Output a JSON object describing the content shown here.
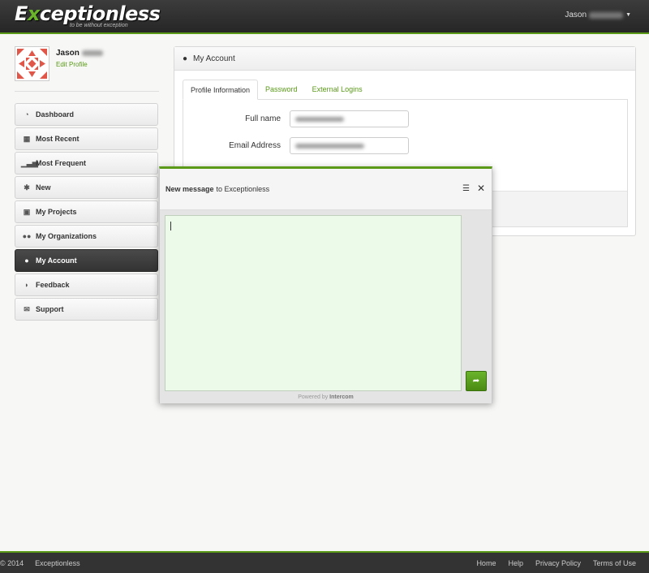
{
  "header": {
    "brand_first": "E",
    "brand_x": "x",
    "brand_rest": "ceptionless",
    "tagline": "to be without exception",
    "user_name": "Jason"
  },
  "profile": {
    "name": "Jason",
    "edit_label": "Edit Profile"
  },
  "sidebar": {
    "items": [
      {
        "label": "Dashboard",
        "icon": "dashboard-icon"
      },
      {
        "label": "Most Recent",
        "icon": "calendar-icon"
      },
      {
        "label": "Most Frequent",
        "icon": "signal-icon"
      },
      {
        "label": "New",
        "icon": "asterisk-icon"
      },
      {
        "label": "My Projects",
        "icon": "briefcase-icon"
      },
      {
        "label": "My Organizations",
        "icon": "group-icon"
      },
      {
        "label": "My Account",
        "icon": "user-icon",
        "active": true
      },
      {
        "label": "Feedback",
        "icon": "comment-icon"
      },
      {
        "label": "Support",
        "icon": "envelope-icon"
      }
    ]
  },
  "main": {
    "title": "My Account",
    "tabs": [
      {
        "label": "Profile Information",
        "active": true
      },
      {
        "label": "Password"
      },
      {
        "label": "External Logins"
      }
    ],
    "fields": {
      "full_name_label": "Full name",
      "email_label": "Email Address"
    }
  },
  "chat": {
    "title_bold": "New message",
    "title_rest": "to Exceptionless",
    "menu_glyph": "☰",
    "close_glyph": "✕",
    "send_glyph": "➦",
    "powered_prefix": "Powered by",
    "powered_brand": "Intercom"
  },
  "footer": {
    "copyright": "© 2014",
    "brand": "Exceptionless",
    "links": [
      "Home",
      "Help",
      "Privacy Policy",
      "Terms of Use"
    ]
  },
  "colors": {
    "accent": "#5a9a18",
    "topbar": "#2f2f2f",
    "chat_textarea": "#ecfbe9"
  }
}
